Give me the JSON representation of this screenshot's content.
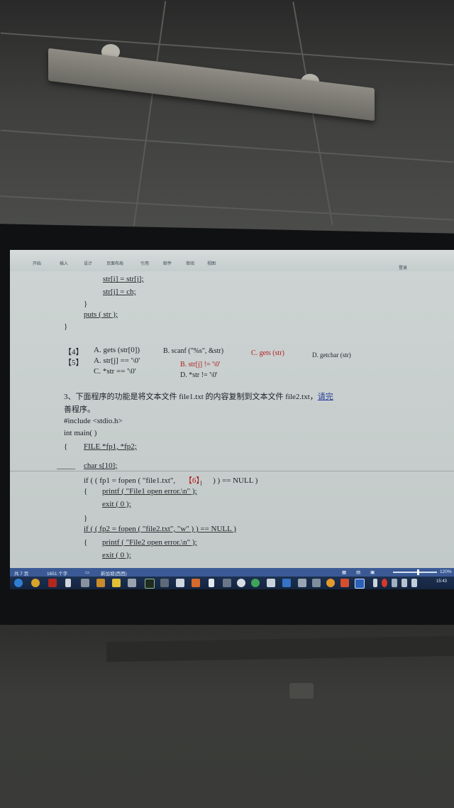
{
  "ribbon": {
    "tabs": [
      "开始",
      "插入",
      "设计",
      "页面布局",
      "引用",
      "邮件",
      "审阅",
      "视图"
    ],
    "right_label": "登录"
  },
  "document": {
    "code_top": [
      "str[i] = str[j];",
      "str[j] = ch;",
      "}",
      "puts ( str );",
      "}"
    ],
    "options": {
      "q4_num": "【4】",
      "q4_a": "A. gets (str[0])",
      "q4_b": "B. scanf (\"%s\", &str)",
      "q4_c": "C. gets (str)",
      "q4_d": "D. getchar (str)",
      "q5_num": "【5】",
      "q5_a": "A. str[j] == '\\0'",
      "q5_b": "B. str[j] != '\\0'",
      "q5_c": "C. *str == '\\0'",
      "q5_d": "D. *str != '\\0'"
    },
    "question3_line1": "3、下面程序的功能是将文本文件 file1.txt 的内容复制到文本文件 file2.txt，",
    "question3_link": "请完",
    "question3_line2": "善程序。",
    "code_bottom": {
      "include": "#include <stdio.h>",
      "main": "int main( )",
      "brace_open": "{",
      "file_decl": "FILE  *fp1, *fp2;",
      "char_decl": "char s[10];",
      "if1_a": "if ( ( fp1 = fopen ( \"file1.txt\",",
      "blank6": "【6】",
      "if1_b": ") ) == NULL )",
      "brace1": "{",
      "printf1": "printf ( \"File1 open error.\\n\" );",
      "exit1": "exit ( 0 );",
      "close1": "}",
      "if2": "if ( ( fp2 = fopen ( \"file2.txt\", \"w\" ) ) == NULL )",
      "brace2": "{",
      "printf2": "printf ( \"File2 open error.\\n\" );",
      "exit2": "exit ( 0 );"
    }
  },
  "statusbar": {
    "pages": "共 7 页",
    "words": "1651 个字",
    "language": "新加坡(西西)",
    "zoom": "120%"
  },
  "taskbar": {
    "clock": "15:43"
  },
  "colors": {
    "screen": "#c9d0d0",
    "statusbar": "#3b5a95",
    "taskbar": "#142540",
    "answer_red": "#b01e1e"
  }
}
